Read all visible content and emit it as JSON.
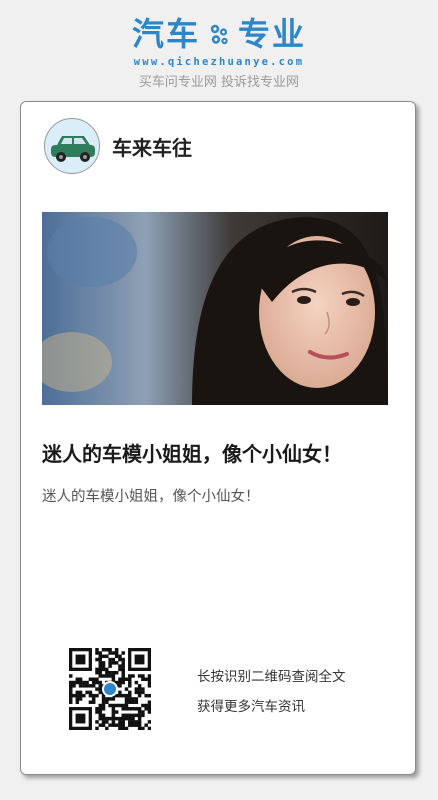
{
  "brand": {
    "logo_left": "汽车",
    "logo_right": "专业",
    "url": "www.qichezhuanye.com",
    "tagline": "买车问专业网 投诉找专业网",
    "accent_color": "#2e86c9",
    "logo_icon": "gear-icon"
  },
  "profile": {
    "name": "车来车往",
    "avatar_icon": "car-icon"
  },
  "article": {
    "image_alt": "woman-photo",
    "title": "迷人的车模小姐姐，像个小仙女！",
    "summary": "迷人的车模小姐姐，像个小仙女！"
  },
  "footer": {
    "qr_icon": "qr-code-icon",
    "line1": "长按识别二维码查阅全文",
    "line2": "获得更多汽车资讯"
  }
}
